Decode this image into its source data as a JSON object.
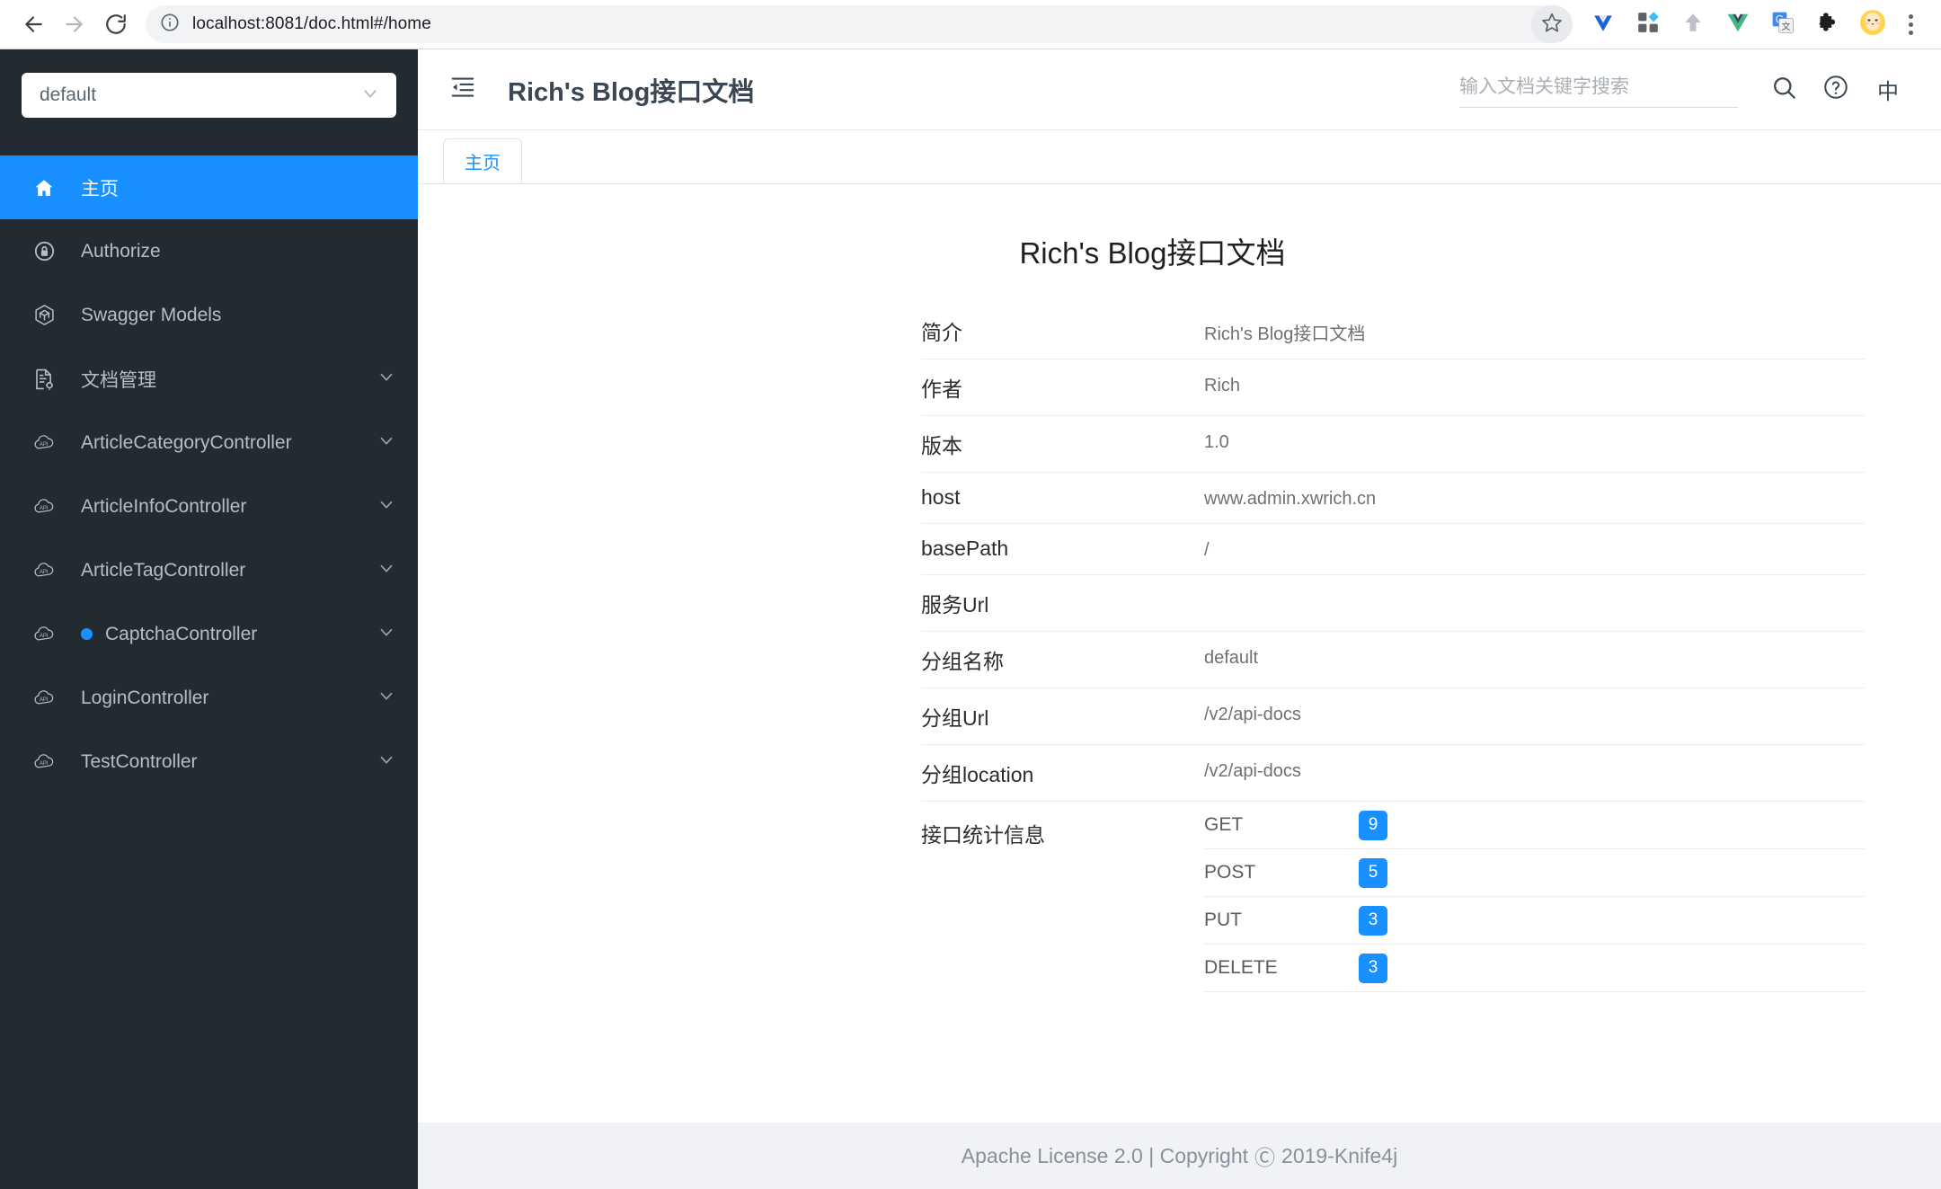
{
  "browser": {
    "back_icon": "arrow-left-icon",
    "forward_icon": "arrow-right-icon",
    "reload_icon": "reload-icon",
    "site_info_icon": "info-circle-icon",
    "url": "localhost:8081/doc.html#/home",
    "bookmark_icon": "star-icon",
    "extensions": [
      {
        "name": "extension-diamond-icon",
        "color": "#1d63d8"
      },
      {
        "name": "extension-apps-grid-icon",
        "color": "#5f6368"
      },
      {
        "name": "extension-upload-arrow-icon",
        "color": "#bdc1c6"
      },
      {
        "name": "extension-vue-devtools-icon",
        "color": "#41b883"
      },
      {
        "name": "extension-google-translate-icon",
        "color": "#4285f4"
      },
      {
        "name": "extension-puzzle-icon",
        "color": "#1f1f1f"
      },
      {
        "name": "profile-avatar-icon",
        "color": "#ffd54f"
      }
    ],
    "menu_icon": "three-dots-vertical-icon"
  },
  "sidebar": {
    "group_select": {
      "value": "default",
      "chevron_icon": "chevron-down-icon"
    },
    "items": [
      {
        "label": "主页",
        "icon": "home-icon",
        "active": true,
        "arrow": false,
        "dot": false
      },
      {
        "label": "Authorize",
        "icon": "lock-icon",
        "active": false,
        "arrow": false,
        "dot": false
      },
      {
        "label": "Swagger Models",
        "icon": "cube-icon",
        "active": false,
        "arrow": false,
        "dot": false
      },
      {
        "label": "文档管理",
        "icon": "doc-gear-icon",
        "active": false,
        "arrow": true,
        "dot": false
      },
      {
        "label": "ArticleCategoryController",
        "icon": "api-cloud-icon",
        "active": false,
        "arrow": true,
        "dot": false
      },
      {
        "label": "ArticleInfoController",
        "icon": "api-cloud-icon",
        "active": false,
        "arrow": true,
        "dot": false
      },
      {
        "label": "ArticleTagController",
        "icon": "api-cloud-icon",
        "active": false,
        "arrow": true,
        "dot": false
      },
      {
        "label": "CaptchaController",
        "icon": "api-cloud-icon",
        "active": false,
        "arrow": true,
        "dot": true
      },
      {
        "label": "LoginController",
        "icon": "api-cloud-icon",
        "active": false,
        "arrow": true,
        "dot": false
      },
      {
        "label": "TestController",
        "icon": "api-cloud-icon",
        "active": false,
        "arrow": true,
        "dot": false
      }
    ]
  },
  "topbar": {
    "fold_icon": "menu-fold-icon",
    "title": "Rich's Blog接口文档",
    "search": {
      "value": "",
      "placeholder": "输入文档关键字搜索",
      "icon": "search-icon"
    },
    "help_icon": "question-circle-icon",
    "lang_label": "中"
  },
  "tabs": [
    {
      "label": "主页",
      "active": true
    }
  ],
  "home": {
    "title": "Rich's Blog接口文档",
    "rows": [
      {
        "key": "简介",
        "value": "Rich's Blog接口文档"
      },
      {
        "key": "作者",
        "value": "Rich"
      },
      {
        "key": "版本",
        "value": "1.0"
      },
      {
        "key": "host",
        "value": "www.admin.xwrich.cn"
      },
      {
        "key": "basePath",
        "value": "/"
      },
      {
        "key": "服务Url",
        "value": ""
      },
      {
        "key": "分组名称",
        "value": "default"
      },
      {
        "key": "分组Url",
        "value": "/v2/api-docs"
      },
      {
        "key": "分组location",
        "value": "/v2/api-docs"
      }
    ],
    "stats_label": "接口统计信息",
    "stats": [
      {
        "method": "GET",
        "count": "9"
      },
      {
        "method": "POST",
        "count": "5"
      },
      {
        "method": "PUT",
        "count": "3"
      },
      {
        "method": "DELETE",
        "count": "3"
      }
    ]
  },
  "footer": {
    "license": "Apache License 2.0 | Copyright",
    "copyright_symbol": "Ⓒ",
    "years": "2019-Knife4j"
  },
  "colors": {
    "accent": "#1890ff",
    "sidebar_bg": "#232b32",
    "footer_bg": "#f0f2f5"
  }
}
